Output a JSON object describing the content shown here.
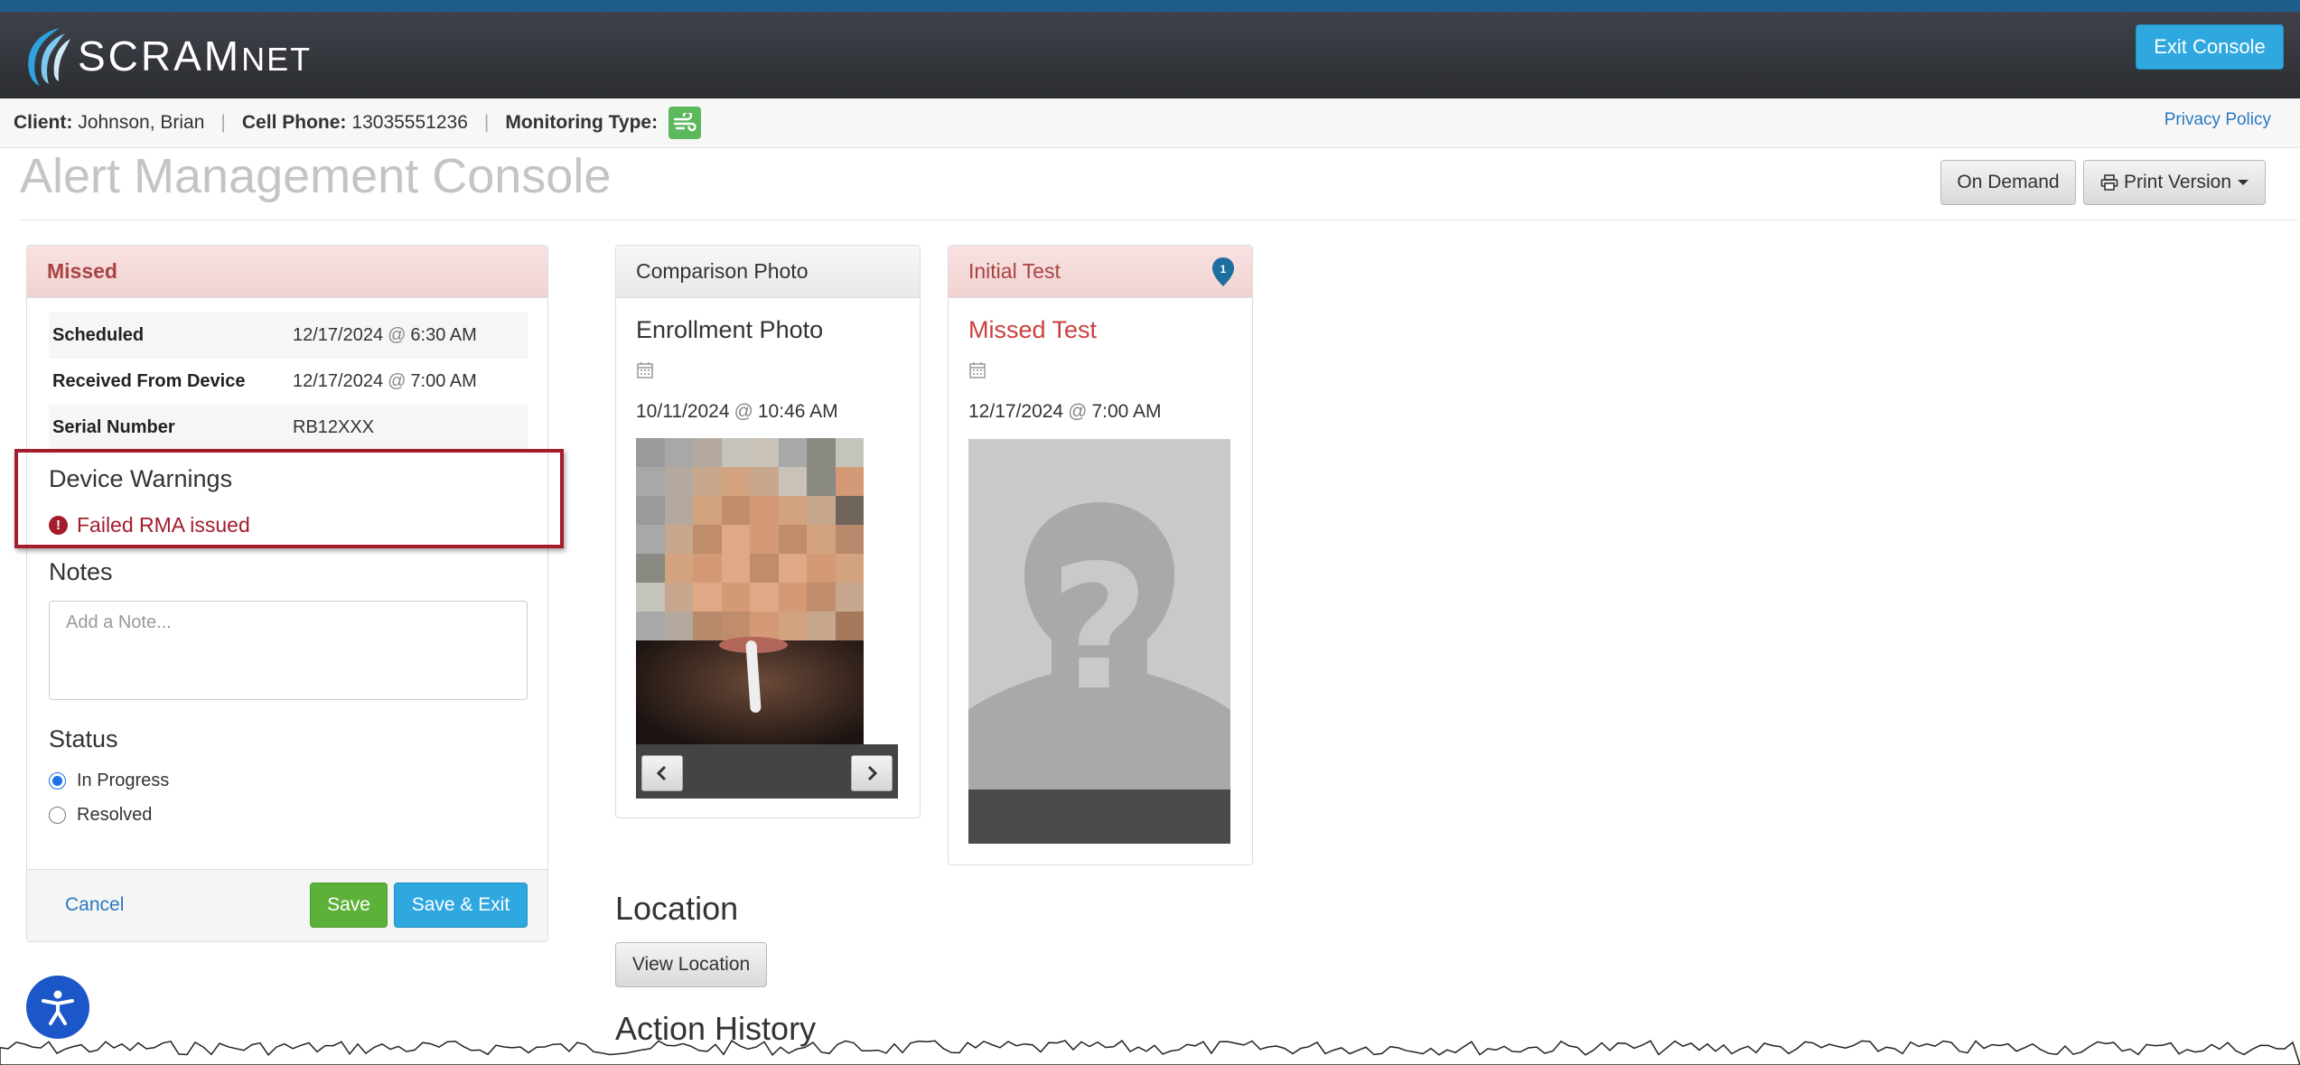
{
  "header": {
    "logo_main": "SCRAM",
    "logo_suffix": "NET",
    "exit_button": "Exit Console",
    "colors": {
      "header_bg": "#2b2d32",
      "accent": "#2fa8e0",
      "top_strip": "#1d5d8c"
    }
  },
  "infobar": {
    "client_label": "Client:",
    "client_value": "Johnson, Brian",
    "phone_label": "Cell Phone:",
    "phone_value": "13035551236",
    "monitoring_label": "Monitoring Type:",
    "monitoring_icon": "wind-icon",
    "privacy_link": "Privacy Policy"
  },
  "page": {
    "title": "Alert Management Console",
    "on_demand": "On Demand",
    "print_version": "Print Version"
  },
  "missed_panel": {
    "heading": "Missed",
    "rows": [
      {
        "label": "Scheduled",
        "date": "12/17/2024",
        "at": "@",
        "time": "6:30 AM"
      },
      {
        "label": "Received From Device",
        "date": "12/17/2024",
        "at": "@",
        "time": "7:00 AM"
      },
      {
        "label": "Serial Number",
        "value": "RB12XXX"
      }
    ],
    "warnings_heading": "Device Warnings",
    "warning": "Failed RMA issued",
    "notes_heading": "Notes",
    "note_placeholder": "Add a Note...",
    "status_heading": "Status",
    "status_options": [
      {
        "label": "In Progress",
        "selected": true
      },
      {
        "label": "Resolved",
        "selected": false
      }
    ],
    "cancel": "Cancel",
    "save": "Save",
    "save_exit": "Save & Exit"
  },
  "comparison_panel": {
    "heading": "Comparison Photo",
    "photo_title": "Enrollment Photo",
    "date": "10/11/2024",
    "at": "@",
    "time": "10:46 AM"
  },
  "initial_panel": {
    "heading": "Initial Test",
    "badge": "1",
    "result": "Missed Test",
    "date": "12/17/2024",
    "at": "@",
    "time": "7:00 AM"
  },
  "location": {
    "heading": "Location",
    "button": "View Location"
  },
  "history": {
    "heading": "Action History"
  }
}
